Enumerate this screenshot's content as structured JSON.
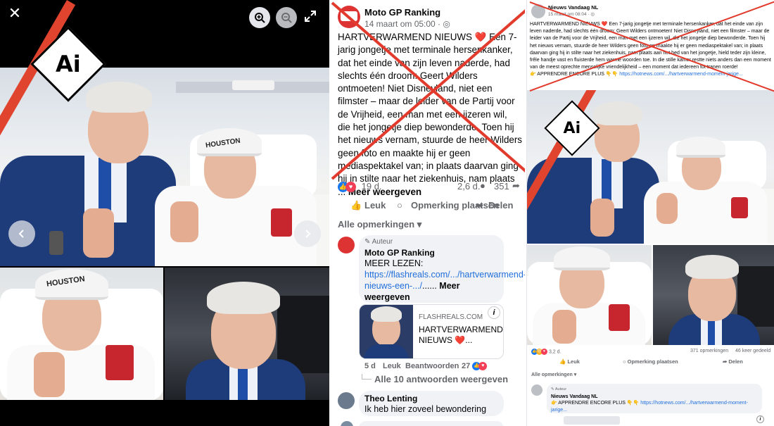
{
  "viewer": {
    "close_label": "✕",
    "zoom_in_icon": "zoom-in-icon",
    "zoom_out_icon": "zoom-out-icon",
    "expand_icon": "expand-icon",
    "prev_icon": "chevron-left-icon",
    "next_icon": "chevron-right-icon",
    "ai_label": "Ai",
    "beanie_text": "HOUSTON"
  },
  "post": {
    "page_name": "Moto GP Ranking",
    "timestamp": "14 maart om 05:00 · ",
    "body": "HARTVERWARMEND NIEUWS ❤️ Een 7-jarig jongetje met terminale hersenkanker, dat het einde van zijn leven naderde, had slechts één droom: Geert Wilders ontmoeten! Niet Disneyland, niet een filmster – maar de leider van de Partij voor de Vrijheid, een man met een ijzeren wil, die het jongetje diep bewonderde. Toen hij het nieuws vernam, stuurde de heer Wilders geen foto en maakte hij er geen mediaspektakel van; in plaats daarvan ging hij in stilte naar het ziekenhuis, nam plaats ... ",
    "see_more": "Meer weergeven",
    "reaction_count": "19 d.",
    "comment_count": "2,6 d.",
    "share_count": "351",
    "like_label": "Leuk",
    "comment_label": "Opmerking plaatsen",
    "share_label": "Delen",
    "filter_label": "Alle opmerkingen",
    "comments": [
      {
        "author_tag": "Auteur",
        "name": "Moto GP Ranking",
        "text": "MEER LEZEN:",
        "link": "https://flashreals.com/.../hartverwarmend-nieuws-een-.../",
        "link_suffix": "...... ",
        "more": "Meer weergeven",
        "card_domain": "FLASHREALS.COM",
        "card_title": "HARTVERWARMEND NIEUWS ❤️...",
        "age": "5 d",
        "like": "Leuk",
        "reply": "Beantwoorden",
        "reactions": "27",
        "replies_label": "Alle 10 antwoorden weergeven"
      },
      {
        "name": "Theo Lenting",
        "text": "Ik heb hier zoveel bewondering"
      }
    ]
  },
  "repost": {
    "page_name": "Nieuws Vandaag NL",
    "timestamp": "15 maart om 08:04 · ",
    "body": "HARTVERWARMEND NIEUWS ❤️ Een 7-jarig jongetje met terminale hersenkanker, dat het einde van zijn leven naderde, had slechts één droom: Geert Wilders ontmoeten! Niet Disneyland, niet een filmster – maar de leider van de Partij voor de Vrijheid, een man met een ijzeren wil, die het jongetje diep bewonderde. Toen hij het nieuws vernam, stuurde de heer Wilders geen foto en maakte hij er geen mediaspektakel van; in plaats daarvan ging hij in stilte naar het ziekenhuis, nam plaats aan het bed van het jongetje, hield teder zijn kleine, frêle handje vast en fluisterde hem warme woorden toe. In die stille kamer restte niets anders dan een moment van de meest oprechte menselijke vriendelijkheid – een moment dat iedereen tot tranen roerde!",
    "cta": "👉 APPRENDRE ENCORE PLUS 👇👇 ",
    "cta_link": "https://hotnews.com/.../hartverwarmend-moment-jarige...",
    "ai_label": "Ai",
    "reaction_count": "3,2 d.",
    "comments_count": "371 opmerkingen",
    "shares_count": "46 keer gedeeld",
    "like_label": "Leuk",
    "comment_label": "Opmerking plaatsen",
    "share_label": "Delen",
    "filter_label": "Alle opmerkingen",
    "comment_author_tag": "Auteur",
    "comment_name": "Nieuws Vandaag NL",
    "comment_text": "👉 APPRENDRE ENCORE PLUS 👇👇 ",
    "comment_link": "https://hotnews.com/.../hartverwarmend-moment-jarige..."
  },
  "colors": {
    "facebook_blue": "#216fdb",
    "cross_red": "#e23a2c",
    "stripe_red": "#e0442e"
  }
}
